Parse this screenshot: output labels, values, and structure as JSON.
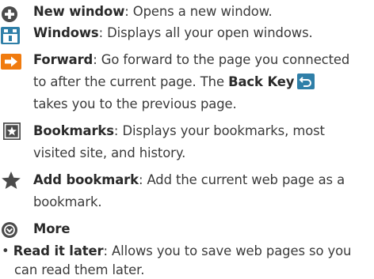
{
  "entries": [
    {
      "icon": "plus-circle-icon",
      "term": "New window",
      "lines": [
        ": Opens a new window."
      ]
    },
    {
      "icon": "windows-icon",
      "term": "Windows",
      "lines": [
        ": Displays all your open windows."
      ]
    },
    {
      "icon": "arrow-right-icon",
      "term": "Forward",
      "lines": [
        ": Go forward to the page you connected",
        "to after the current page. The ",
        "takes you to the previous page."
      ],
      "back_key_label": "Back Key"
    },
    {
      "icon": "bookmark-icon",
      "term": "Bookmarks",
      "lines": [
        ": Displays your bookmarks, most",
        "visited site, and history."
      ]
    },
    {
      "icon": "star-icon",
      "term": "Add bookmark",
      "lines": [
        ": Add the current web page as a",
        "bookmark."
      ]
    },
    {
      "icon": "more-chevron-icon",
      "term": "More",
      "lines": []
    }
  ],
  "bullets": [
    {
      "marker": "•",
      "term": "Read it later",
      "lines": [
        ": Allows you to save web pages so you",
        "can read them later."
      ]
    }
  ],
  "colors": {
    "icon_gray": "#4b4b4b",
    "icon_blue": "#2f7fa8",
    "icon_orange": "#f07b0f",
    "text": "#3a3a3a"
  }
}
